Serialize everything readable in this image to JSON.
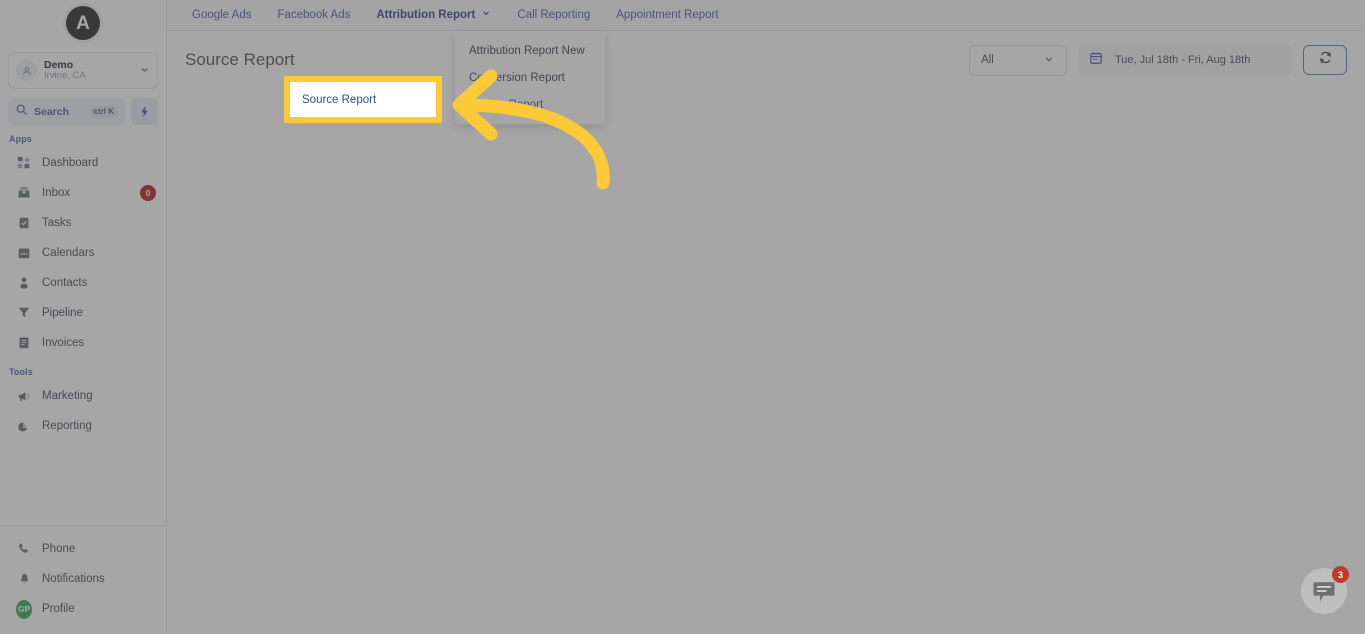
{
  "app": {
    "logo_letter": "A"
  },
  "sidebar": {
    "account": {
      "name": "Demo",
      "location": "Irvine, CA"
    },
    "search": {
      "label": "Search",
      "shortcut": "ctrl K"
    },
    "sections": [
      {
        "label": "Apps"
      },
      {
        "label": "Tools"
      }
    ],
    "apps": [
      {
        "label": "Dashboard",
        "icon": "grid-icon",
        "badge": null
      },
      {
        "label": "Inbox",
        "icon": "inbox-icon",
        "badge": "0"
      },
      {
        "label": "Tasks",
        "icon": "task-icon",
        "badge": null
      },
      {
        "label": "Calendars",
        "icon": "calendar-icon",
        "badge": null
      },
      {
        "label": "Contacts",
        "icon": "contacts-icon",
        "badge": null
      },
      {
        "label": "Pipeline",
        "icon": "pipeline-icon",
        "badge": null
      },
      {
        "label": "Invoices",
        "icon": "invoice-icon",
        "badge": null
      }
    ],
    "tools": [
      {
        "label": "Marketing",
        "icon": "megaphone-icon",
        "badge": null
      },
      {
        "label": "Reporting",
        "icon": "pie-chart-icon",
        "badge": null
      }
    ],
    "bottom": [
      {
        "label": "Phone",
        "icon": "phone-icon"
      },
      {
        "label": "Notifications",
        "icon": "bell-icon"
      },
      {
        "label": "Profile",
        "icon": "avatar-gp",
        "initials": "GP"
      }
    ]
  },
  "topbar": {
    "tabs": [
      {
        "label": "Google Ads",
        "active": false
      },
      {
        "label": "Facebook Ads",
        "active": false
      },
      {
        "label": "Attribution Report",
        "active": true
      },
      {
        "label": "Call Reporting",
        "active": false
      },
      {
        "label": "Appointment Report",
        "active": false
      }
    ]
  },
  "header": {
    "page_title": "Source Report",
    "filter_value": "All",
    "date_range": "Tue, Jul 18th - Fri, Aug 18th",
    "refresh_label": "refresh-icon"
  },
  "dropdown": {
    "items": [
      {
        "label": "Attribution Report New",
        "highlighted": false
      },
      {
        "label": "Conversion Report",
        "highlighted": false
      },
      {
        "label": "Source Report",
        "highlighted": true
      }
    ]
  },
  "annotation": {
    "arrow_color": "#fcc938",
    "highlight_color": "#fcc938",
    "highlight_target": "Source Report"
  },
  "chat": {
    "badge_count": "3",
    "icon": "chat-bubble-icon"
  },
  "colors": {
    "accent_blue": "#3a51a8",
    "badge_red": "#b80d0d",
    "profile_green": "#29a746",
    "annotation_yellow": "#fcc938",
    "overlay_gray": "#7a7a7a"
  }
}
